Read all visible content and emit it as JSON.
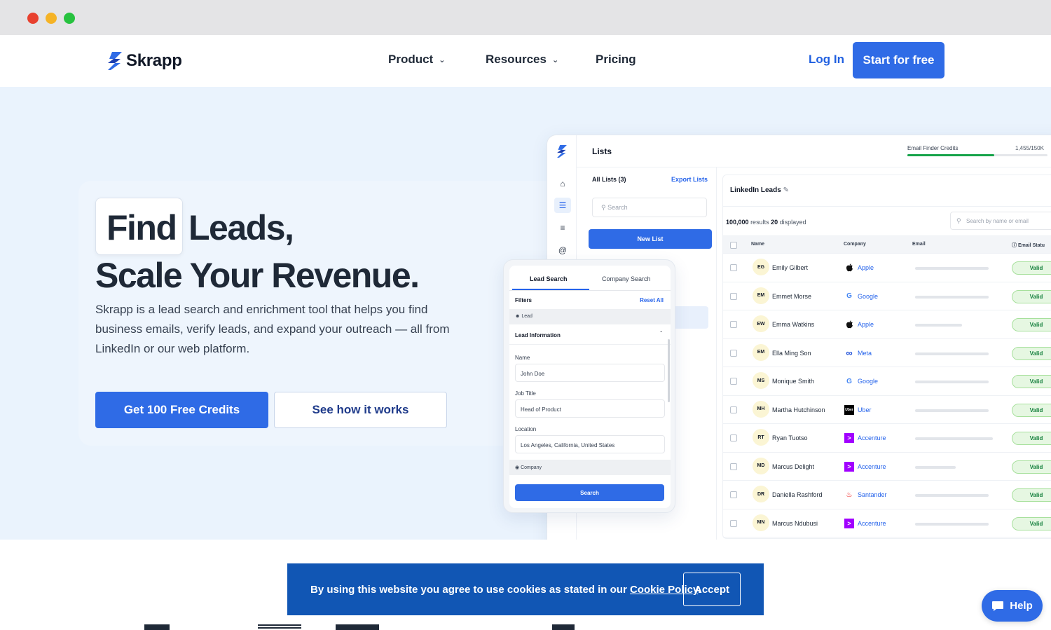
{
  "nav": {
    "brand": "Skrapp",
    "items": [
      {
        "label": "Product",
        "has_dropdown": true
      },
      {
        "label": "Resources",
        "has_dropdown": true
      },
      {
        "label": "Pricing",
        "has_dropdown": false
      }
    ],
    "login": "Log In",
    "start": "Start for free"
  },
  "hero": {
    "word_find": "Find",
    "word_leads": "Leads,",
    "line2": "Scale Your Revenue.",
    "description": "Skrapp is a lead search and enrichment tool that helps you find business emails, verify leads, and expand your outreach — all from LinkedIn or our web platform.",
    "cta_primary": "Get 100 Free Credits",
    "cta_secondary": "See how it works"
  },
  "app": {
    "title": "Lists",
    "credits_label": "Email Finder Credits",
    "credits_value": "1,455/150K",
    "credits_fraction": 0.62,
    "lists_header": "All Lists (3)",
    "export": "Export Lists",
    "search_placeholder": "Search",
    "new_list": "New List",
    "list_name": "LinkedIn Leads",
    "results_count": "100,000",
    "results_label": "results",
    "displayed_count": "20",
    "displayed_label": "displayed",
    "name_search_placeholder": "Search by name or email",
    "columns": {
      "name": "Name",
      "company": "Company",
      "email": "Email",
      "status": "Email Statu"
    },
    "rows": [
      {
        "initials": "EG",
        "name": "Emily Gilbert",
        "company": "Apple",
        "icon": "apple-icon",
        "email_frac": 0.74,
        "status": "Valid"
      },
      {
        "initials": "EM",
        "name": "Emmet Morse",
        "company": "Google",
        "icon": "google-icon",
        "email_frac": 0.74,
        "status": "Valid"
      },
      {
        "initials": "EW",
        "name": "Emma Watkins",
        "company": "Apple",
        "icon": "apple-icon",
        "email_frac": 0.47,
        "status": "Valid"
      },
      {
        "initials": "EM",
        "name": "Ella Ming Son",
        "company": "Meta",
        "icon": "meta-icon",
        "email_frac": 0.74,
        "status": "Valid"
      },
      {
        "initials": "MS",
        "name": "Monique Smith",
        "company": "Google",
        "icon": "google-icon",
        "email_frac": 0.74,
        "status": "Valid"
      },
      {
        "initials": "MH",
        "name": "Martha Hutchinson",
        "company": "Uber",
        "icon": "uber-icon",
        "email_frac": 0.74,
        "status": "Valid"
      },
      {
        "initials": "RT",
        "name": "Ryan Tuotso",
        "company": "Accenture",
        "icon": "accenture-icon",
        "email_frac": 0.78,
        "status": "Valid"
      },
      {
        "initials": "MD",
        "name": "Marcus Delight",
        "company": "Accenture",
        "icon": "accenture-icon",
        "email_frac": 0.41,
        "status": "Valid"
      },
      {
        "initials": "DR",
        "name": "Daniella Rashford",
        "company": "Santander",
        "icon": "santander-icon",
        "email_frac": 0.74,
        "status": "Valid"
      },
      {
        "initials": "MN",
        "name": "Marcus Ndubusi",
        "company": "Accenture",
        "icon": "accenture-icon",
        "email_frac": 0.74,
        "status": "Valid"
      }
    ]
  },
  "lead_search": {
    "tab_lead": "Lead Search",
    "tab_company": "Company Search",
    "filters": "Filters",
    "reset": "Reset All",
    "section_lead": "Lead",
    "lead_info": "Lead Information",
    "name_label": "Name",
    "name_value": "John Doe",
    "job_label": "Job Title",
    "job_value": "Head of Product",
    "location_label": "Location",
    "location_value": "Los Angeles, California, United States",
    "section_company": "Company",
    "search_button": "Search"
  },
  "cookie": {
    "text": "By using this website you agree to use cookies as stated in our ",
    "link": "Cookie Policy",
    "period": ".",
    "accept": "Accept"
  },
  "help": "Help",
  "colors": {
    "primary": "#2f6be6",
    "brand_dark": "#1156b4",
    "valid_green": "#15803d",
    "hero_bg": "#eaf3fd"
  }
}
